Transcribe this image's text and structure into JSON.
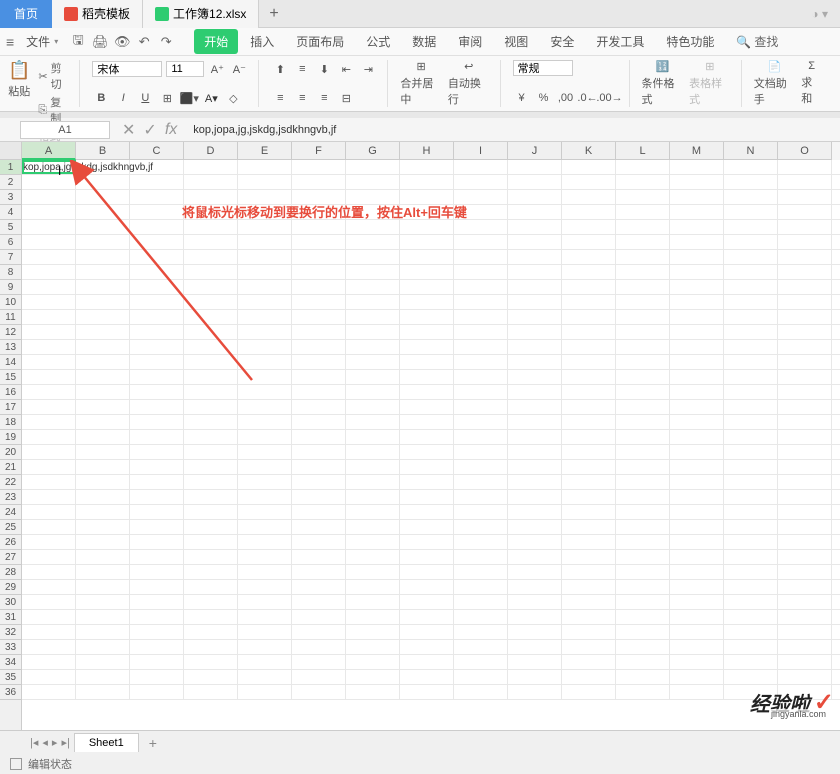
{
  "tabs": {
    "home": "首页",
    "template": "稻壳模板",
    "file": "工作簿12.xlsx"
  },
  "menu": {
    "file": "文件",
    "tabs": [
      "开始",
      "插入",
      "页面布局",
      "公式",
      "数据",
      "审阅",
      "视图",
      "安全",
      "开发工具",
      "特色功能"
    ],
    "search": "查找"
  },
  "ribbon": {
    "paste": "粘贴",
    "cut": "剪切",
    "copy": "复制",
    "format_painter": "格式刷",
    "font_name": "宋体",
    "font_size": "11",
    "merge": "合并居中",
    "wrap": "自动换行",
    "number_format": "常规",
    "cond_format": "条件格式",
    "table_style": "表格样式",
    "doc_helper": "文档助手",
    "sum": "求和"
  },
  "formula_bar": {
    "name_box": "A1",
    "formula": "kop,jopa,jg,jskdg,jsdkhngvb,jf"
  },
  "columns": [
    "A",
    "B",
    "C",
    "D",
    "E",
    "F",
    "G",
    "H",
    "I",
    "J",
    "K",
    "L",
    "M",
    "N",
    "O"
  ],
  "rows": [
    "1",
    "2",
    "3",
    "4",
    "5",
    "6",
    "7",
    "8",
    "9",
    "10",
    "11",
    "12",
    "13",
    "14",
    "15",
    "16",
    "17",
    "18",
    "19",
    "20",
    "21",
    "22",
    "23",
    "24",
    "25",
    "26",
    "27",
    "28",
    "29",
    "30",
    "31",
    "32",
    "33",
    "34",
    "35",
    "36"
  ],
  "cell_a1": "kop,jopa,jg,jskdg,jsdkhngvb,jf",
  "annotation_text": "将鼠标光标移动到要换行的位置，按住Alt+回车键",
  "sheet": {
    "name": "Sheet1"
  },
  "status": "编辑状态",
  "watermark": {
    "text": "经验啦",
    "url": "jingyanla.com"
  }
}
